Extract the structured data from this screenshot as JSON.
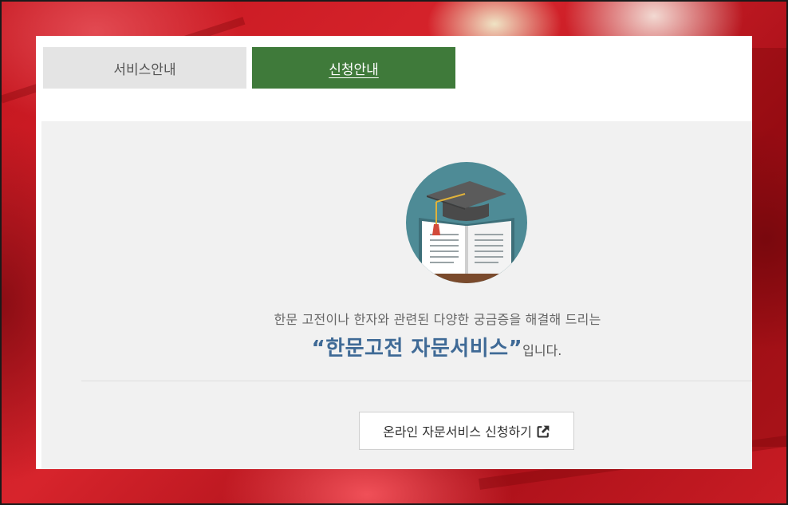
{
  "tabs": [
    {
      "label": "서비스안내",
      "active": false
    },
    {
      "label": "신청안내",
      "active": true
    }
  ],
  "intro": {
    "description": "한문 고전이나 한자와 관련된 다양한 궁금증을 해결해 드리는",
    "service_name": "“한문고전 자문서비스”",
    "suffix": "입니다."
  },
  "apply_button": {
    "label": "온라인 자문서비스 신청하기",
    "icon": "external-link-icon"
  },
  "colors": {
    "active_tab": "#3f7a3a",
    "inactive_tab": "#e4e4e4",
    "service_name": "#3f6a96",
    "background": "#b8121c"
  }
}
